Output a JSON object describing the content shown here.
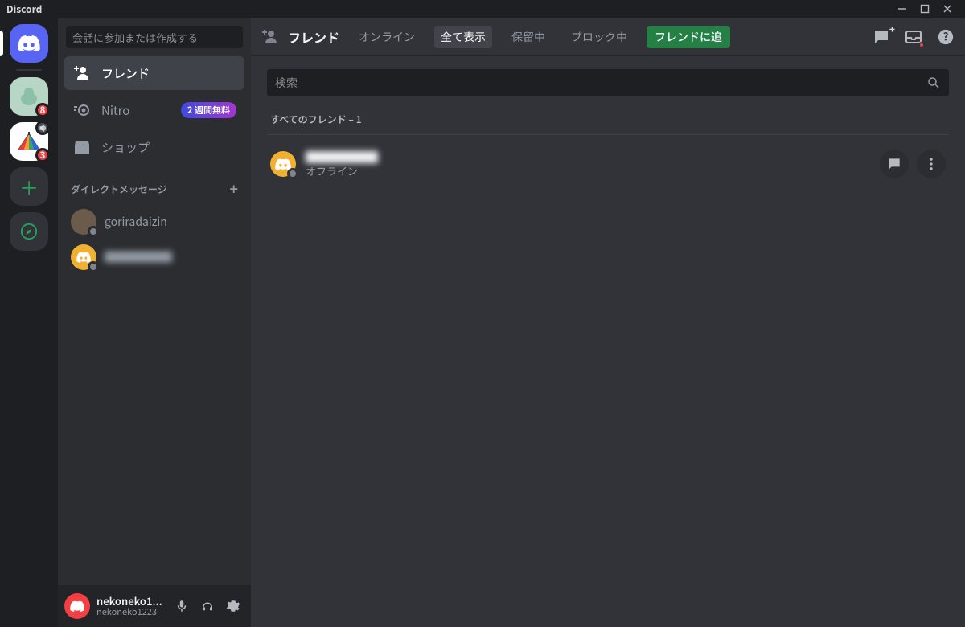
{
  "titlebar": {
    "brand": "Discord"
  },
  "servers": {
    "items": [
      {
        "id": "home",
        "badge": ""
      },
      {
        "id": "s1",
        "badge": "8",
        "voice": false
      },
      {
        "id": "s2",
        "badge": "3",
        "voice": true
      }
    ]
  },
  "sidebar": {
    "search_placeholder": "会話に参加または作成する",
    "friends_label": "フレンド",
    "nitro_label": "Nitro",
    "nitro_pill": "2 週間無料",
    "shop_label": "ショップ",
    "dm_header": "ダイレクトメッセージ",
    "dms": [
      {
        "name": "goriradaizin"
      },
      {
        "name": "██████"
      }
    ]
  },
  "userpanel": {
    "display": "nekoneko1...",
    "tag": "nekoneko1223"
  },
  "topbar": {
    "title": "フレンド",
    "tabs": {
      "online": "オンライン",
      "all": "全て表示",
      "pending": "保留中",
      "blocked": "ブロック中",
      "add": "フレンドに追"
    }
  },
  "content": {
    "search_placeholder": "検索",
    "section_label": "すべてのフレンド – 1",
    "friend": {
      "name": "██████",
      "status": "オフライン"
    }
  }
}
